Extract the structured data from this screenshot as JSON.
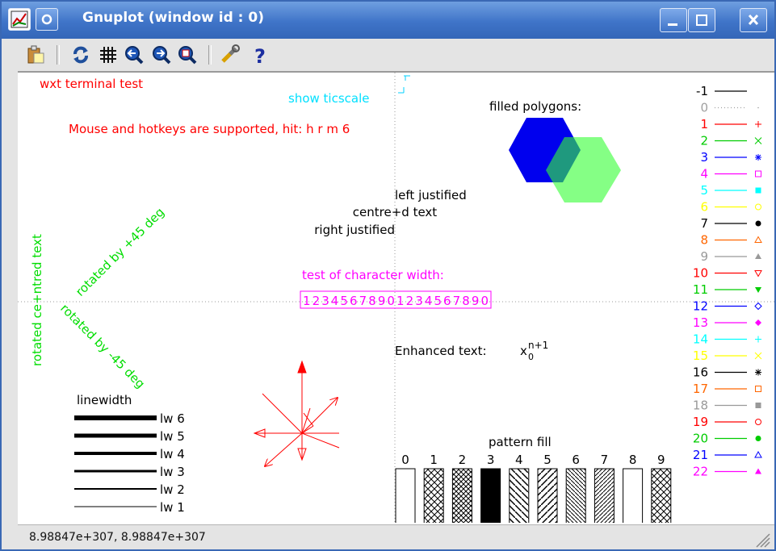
{
  "window": {
    "title": "Gnuplot (window id : 0)"
  },
  "toolbar": {
    "icons": [
      "clipboard-icon",
      "replot-icon",
      "grid-icon",
      "zoom-previous-icon",
      "zoom-next-icon",
      "unzoom-icon",
      "settings-wrench-icon",
      "help-icon"
    ]
  },
  "plot": {
    "terminal_label": "wxt  terminal test",
    "show_ticscale": "show ticscale",
    "mouse_hotkeys": "Mouse and hotkeys are supported, hit: h r m 6",
    "filled_polygons": "filled polygons:",
    "left_justified": "left justified",
    "centred_text": "centre+d text",
    "right_justified": "right justified",
    "rotated_centred": "rotated ce+ntred text",
    "rotated_plus45": "rotated by +45 deg",
    "rotated_minus45": "rotated by -45 deg",
    "char_width_label": "test of character width:",
    "char_width_digits": "12345678901234567890",
    "enhanced_label": "Enhanced text:",
    "enhanced_base": "x",
    "enhanced_sub": "0",
    "enhanced_sup": "n+1",
    "linewidth_title": "linewidth",
    "linewidths": [
      "lw 6",
      "lw 5",
      "lw 4",
      "lw 3",
      "lw 2",
      "lw 1"
    ],
    "pattern_fill_title": "pattern fill",
    "patterns": [
      "0",
      "1",
      "2",
      "3",
      "4",
      "5",
      "6",
      "7",
      "8",
      "9"
    ],
    "legend": [
      {
        "label": "-1",
        "color": "#000000"
      },
      {
        "label": "0",
        "color": "#a0a0a0"
      },
      {
        "label": "1",
        "color": "#ff0000"
      },
      {
        "label": "2",
        "color": "#00cc00"
      },
      {
        "label": "3",
        "color": "#0000ff"
      },
      {
        "label": "4",
        "color": "#ff00ff"
      },
      {
        "label": "5",
        "color": "#00ffff"
      },
      {
        "label": "6",
        "color": "#ffff00"
      },
      {
        "label": "7",
        "color": "#000000"
      },
      {
        "label": "8",
        "color": "#ff6600"
      },
      {
        "label": "9",
        "color": "#999999"
      },
      {
        "label": "10",
        "color": "#ff0000"
      },
      {
        "label": "11",
        "color": "#00cc00"
      },
      {
        "label": "12",
        "color": "#0000ff"
      },
      {
        "label": "13",
        "color": "#ff00ff"
      },
      {
        "label": "14",
        "color": "#00ffff"
      },
      {
        "label": "15",
        "color": "#ffff00"
      },
      {
        "label": "16",
        "color": "#000000"
      },
      {
        "label": "17",
        "color": "#ff6600"
      },
      {
        "label": "18",
        "color": "#999999"
      },
      {
        "label": "19",
        "color": "#ff0000"
      },
      {
        "label": "20",
        "color": "#00cc00"
      },
      {
        "label": "21",
        "color": "#0000ff"
      },
      {
        "label": "22",
        "color": "#ff00ff"
      }
    ],
    "colors": {
      "red": "#ff0000",
      "cyan": "#00ffff",
      "green": "#00ff00",
      "magenta": "#ff00ff",
      "blue": "#0000ff",
      "lightgreen": "#66ff66"
    }
  },
  "status": {
    "coords": "8.98847e+307, 8.98847e+307"
  }
}
